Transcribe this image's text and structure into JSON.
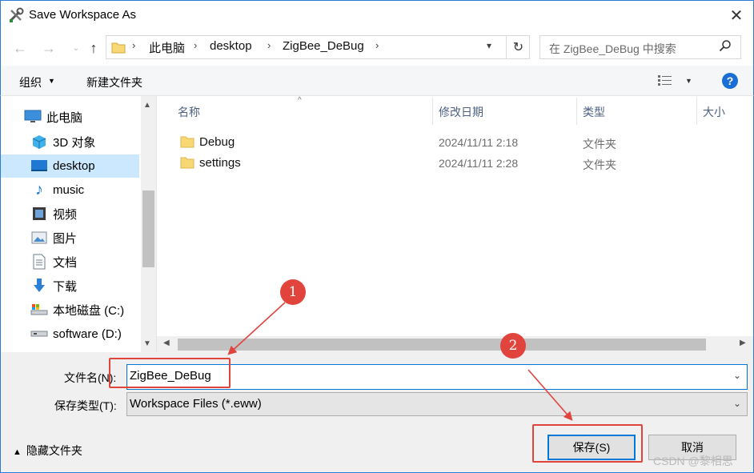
{
  "window": {
    "title": "Save Workspace As",
    "close_glyph": "✕"
  },
  "nav": {
    "back": "←",
    "forward": "→",
    "recent": "⌄",
    "up": "↑"
  },
  "address": {
    "separator": "›",
    "crumbs": [
      "此电脑",
      "desktop",
      "ZigBee_DeBug"
    ],
    "refresh_glyph": "↻"
  },
  "search": {
    "placeholder": "在 ZigBee_DeBug 中搜索"
  },
  "toolbar": {
    "organize": "组织",
    "new_folder": "新建文件夹",
    "help": "?"
  },
  "sidebar": {
    "items": [
      {
        "label": "此电脑",
        "icon": "computer-icon"
      },
      {
        "label": "3D 对象",
        "icon": "cube-icon"
      },
      {
        "label": "desktop",
        "icon": "desktop-icon",
        "selected": true
      },
      {
        "label": "music",
        "icon": "music-note-icon"
      },
      {
        "label": "视频",
        "icon": "film-icon"
      },
      {
        "label": "图片",
        "icon": "picture-icon"
      },
      {
        "label": "文档",
        "icon": "document-icon"
      },
      {
        "label": "下载",
        "icon": "download-arrow-icon"
      },
      {
        "label": "本地磁盘 (C:)",
        "icon": "drive-c-icon"
      },
      {
        "label": "software (D:)",
        "icon": "drive-icon"
      }
    ]
  },
  "filelist": {
    "columns": [
      "名称",
      "修改日期",
      "类型",
      "大小"
    ],
    "rows": [
      {
        "name": "Debug",
        "modified": "2024/11/11 2:18",
        "type": "文件夹"
      },
      {
        "name": "settings",
        "modified": "2024/11/11 2:28",
        "type": "文件夹"
      }
    ]
  },
  "form": {
    "filename_label": "文件名(N):",
    "filename_value": "ZigBee_DeBug",
    "filetype_label": "保存类型(T):",
    "filetype_value": "Workspace Files (*.eww)"
  },
  "footer": {
    "hide_folders": "隐藏文件夹",
    "save": "保存(S)",
    "cancel": "取消"
  },
  "annotations": {
    "badge1": "1",
    "badge2": "2",
    "color": "#e0443d"
  },
  "watermark": "CSDN @黎相思",
  "colors": {
    "accent": "#0078d7",
    "selection": "#cce8ff",
    "folder": "#f8d775"
  }
}
